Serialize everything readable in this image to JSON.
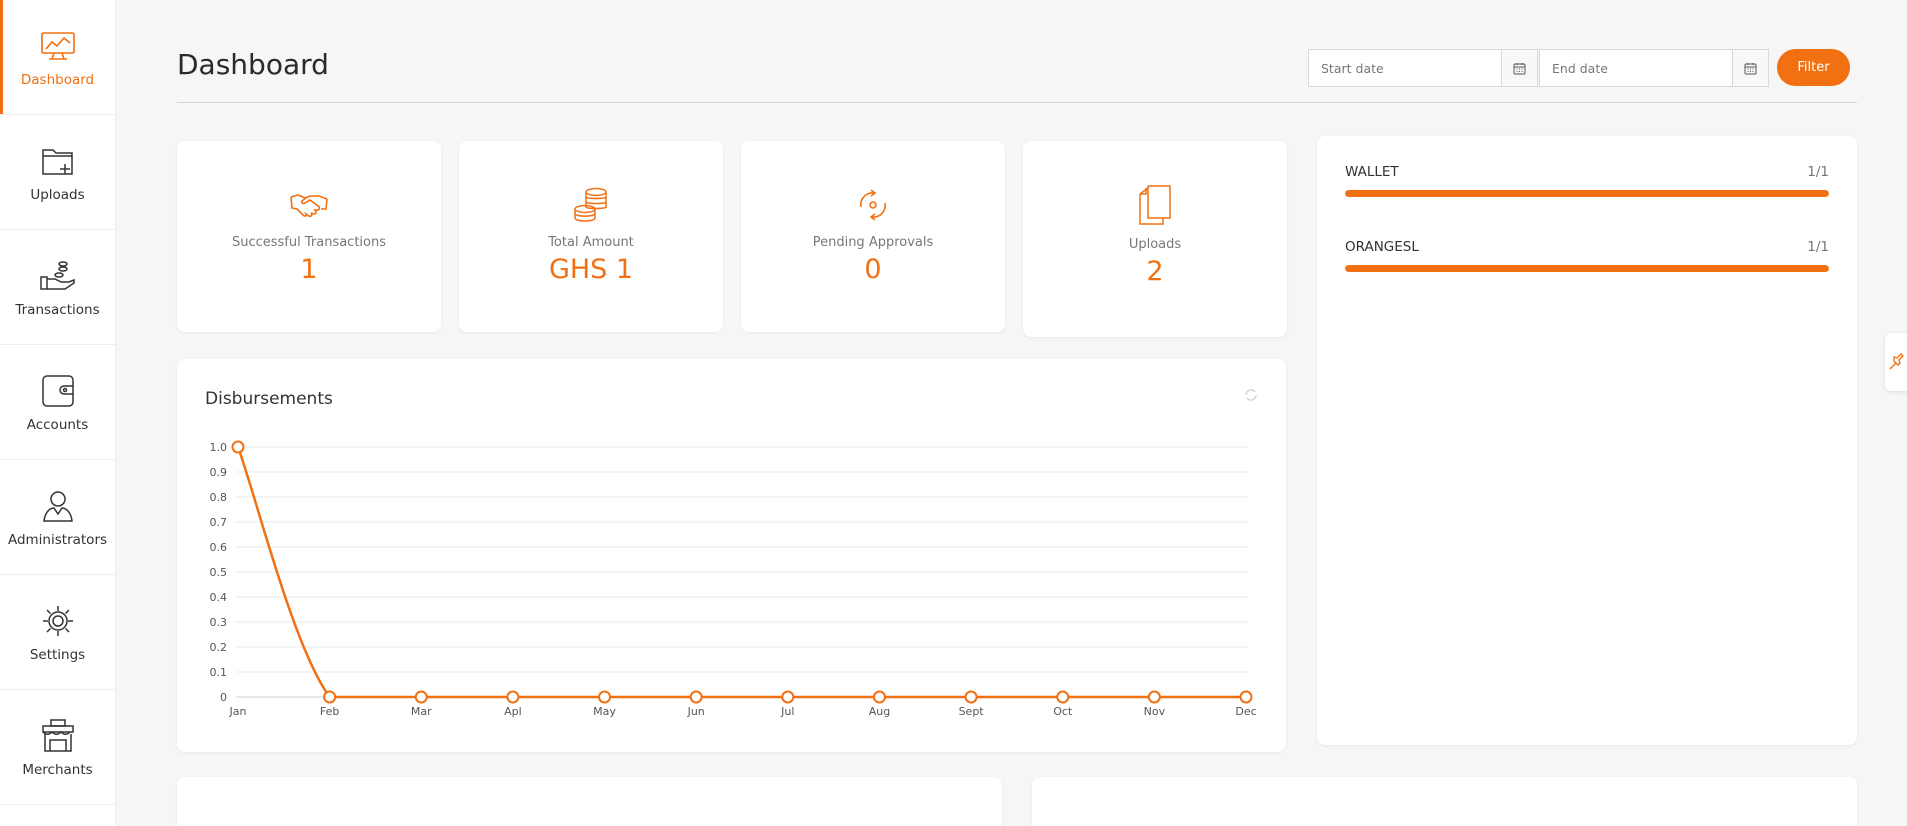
{
  "sidebar": {
    "items": [
      {
        "label": "Dashboard",
        "icon": "monitor-icon",
        "active": true
      },
      {
        "label": "Uploads",
        "icon": "folder-add-icon"
      },
      {
        "label": "Transactions",
        "icon": "hand-coins-icon"
      },
      {
        "label": "Accounts",
        "icon": "wallet-icon"
      },
      {
        "label": "Administrators",
        "icon": "admin-user-icon"
      },
      {
        "label": "Settings",
        "icon": "gear-icon"
      },
      {
        "label": "Merchants",
        "icon": "store-icon"
      }
    ]
  },
  "header": {
    "title": "Dashboard",
    "start_placeholder": "Start date",
    "end_placeholder": "End date",
    "filter_label": "Filter"
  },
  "stats": [
    {
      "label": "Successful Transactions",
      "value": "1",
      "icon": "handshake-icon"
    },
    {
      "label": "Total Amount",
      "value": "GHS 1",
      "icon": "coins-icon"
    },
    {
      "label": "Pending Approvals",
      "value": "0",
      "icon": "sync-icon"
    },
    {
      "label": "Uploads",
      "value": "2",
      "icon": "documents-icon"
    }
  ],
  "channels": [
    {
      "name": "WALLET",
      "ratio": "1/1",
      "fraction": 1.0
    },
    {
      "name": "ORANGESL",
      "ratio": "1/1",
      "fraction": 1.0
    }
  ],
  "chart_data": {
    "type": "line",
    "title": "Disbursements",
    "categories": [
      "Jan",
      "Feb",
      "Mar",
      "Apl",
      "May",
      "Jun",
      "Jul",
      "Aug",
      "Sept",
      "Oct",
      "Nov",
      "Dec"
    ],
    "series": [
      {
        "values": [
          1,
          0,
          0,
          0,
          0,
          0,
          0,
          0,
          0,
          0,
          0,
          0
        ]
      }
    ],
    "ylim": [
      0,
      1
    ],
    "yticks": [
      "0",
      "0.1",
      "0.2",
      "0.3",
      "0.4",
      "0.5",
      "0.6",
      "0.7",
      "0.8",
      "0.9",
      "1.0"
    ],
    "grid": true,
    "color": "#f07012"
  },
  "colors": {
    "accent": "#f07012"
  }
}
